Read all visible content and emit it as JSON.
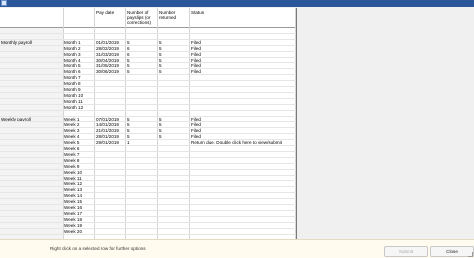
{
  "columns": {
    "pay_date": "Pay date",
    "num_payslips": "Number of payslips (or corrections)",
    "num_returned": "Number returned",
    "status": "Status"
  },
  "groups": [
    {
      "label": "Monthly payroll",
      "rows": [
        {
          "period": "Month 1",
          "date": "01/01/2019",
          "payslips": "5",
          "returned": "5",
          "status": "Filed"
        },
        {
          "period": "Month 2",
          "date": "28/02/2019",
          "payslips": "6",
          "returned": "5",
          "status": "Filed"
        },
        {
          "period": "Month 3",
          "date": "31/03/2019",
          "payslips": "6",
          "returned": "5",
          "status": "Filed"
        },
        {
          "period": "Month 4",
          "date": "30/04/2019",
          "payslips": "5",
          "returned": "5",
          "status": "Filed"
        },
        {
          "period": "Month 5",
          "date": "31/05/2019",
          "payslips": "5",
          "returned": "5",
          "status": "Filed"
        },
        {
          "period": "Month 6",
          "date": "30/06/2019",
          "payslips": "5",
          "returned": "5",
          "status": "Filed"
        },
        {
          "period": "Month 7",
          "date": "",
          "payslips": "",
          "returned": "",
          "status": ""
        },
        {
          "period": "Month 8",
          "date": "",
          "payslips": "",
          "returned": "",
          "status": ""
        },
        {
          "period": "Month 9",
          "date": "",
          "payslips": "",
          "returned": "",
          "status": ""
        },
        {
          "period": "Month 10",
          "date": "",
          "payslips": "",
          "returned": "",
          "status": ""
        },
        {
          "period": "Month 11",
          "date": "",
          "payslips": "",
          "returned": "",
          "status": ""
        },
        {
          "period": "Month 12",
          "date": "",
          "payslips": "",
          "returned": "",
          "status": ""
        }
      ]
    },
    {
      "label": "Weekly payroll",
      "rows": [
        {
          "period": "Week 1",
          "date": "07/01/2019",
          "payslips": "5",
          "returned": "5",
          "status": "Filed"
        },
        {
          "period": "Week 2",
          "date": "14/01/2019",
          "payslips": "5",
          "returned": "5",
          "status": "Filed"
        },
        {
          "period": "Week 3",
          "date": "21/01/2019",
          "payslips": "5",
          "returned": "5",
          "status": "Filed"
        },
        {
          "period": "Week 4",
          "date": "28/01/2019",
          "payslips": "5",
          "returned": "5",
          "status": "Filed"
        },
        {
          "period": "Week 5",
          "date": "29/01/2019",
          "payslips": "1",
          "returned": "",
          "status": "Return due. Double click here to view/submit"
        },
        {
          "period": "Week 6",
          "date": "",
          "payslips": "",
          "returned": "",
          "status": ""
        },
        {
          "period": "Week 7",
          "date": "",
          "payslips": "",
          "returned": "",
          "status": ""
        },
        {
          "period": "Week 8",
          "date": "",
          "payslips": "",
          "returned": "",
          "status": ""
        },
        {
          "period": "Week 9",
          "date": "",
          "payslips": "",
          "returned": "",
          "status": ""
        },
        {
          "period": "Week 10",
          "date": "",
          "payslips": "",
          "returned": "",
          "status": ""
        },
        {
          "period": "Week 11",
          "date": "",
          "payslips": "",
          "returned": "",
          "status": ""
        },
        {
          "period": "Week 12",
          "date": "",
          "payslips": "",
          "returned": "",
          "status": ""
        },
        {
          "period": "Week 13",
          "date": "",
          "payslips": "",
          "returned": "",
          "status": ""
        },
        {
          "period": "Week 14",
          "date": "",
          "payslips": "",
          "returned": "",
          "status": ""
        },
        {
          "period": "Week 15",
          "date": "",
          "payslips": "",
          "returned": "",
          "status": ""
        },
        {
          "period": "Week 16",
          "date": "",
          "payslips": "",
          "returned": "",
          "status": ""
        },
        {
          "period": "Week 17",
          "date": "",
          "payslips": "",
          "returned": "",
          "status": ""
        },
        {
          "period": "Week 18",
          "date": "",
          "payslips": "",
          "returned": "",
          "status": ""
        },
        {
          "period": "Week 19",
          "date": "",
          "payslips": "",
          "returned": "",
          "status": ""
        },
        {
          "period": "Week 20",
          "date": "",
          "payslips": "",
          "returned": "",
          "status": ""
        }
      ]
    }
  ],
  "footer": {
    "hint": "Right click on a selected row for further options",
    "submit_label": "Submit",
    "close_label": "Close"
  },
  "colors": {
    "titlebar": "#2b579a",
    "footer_bg": "#fffbee"
  }
}
